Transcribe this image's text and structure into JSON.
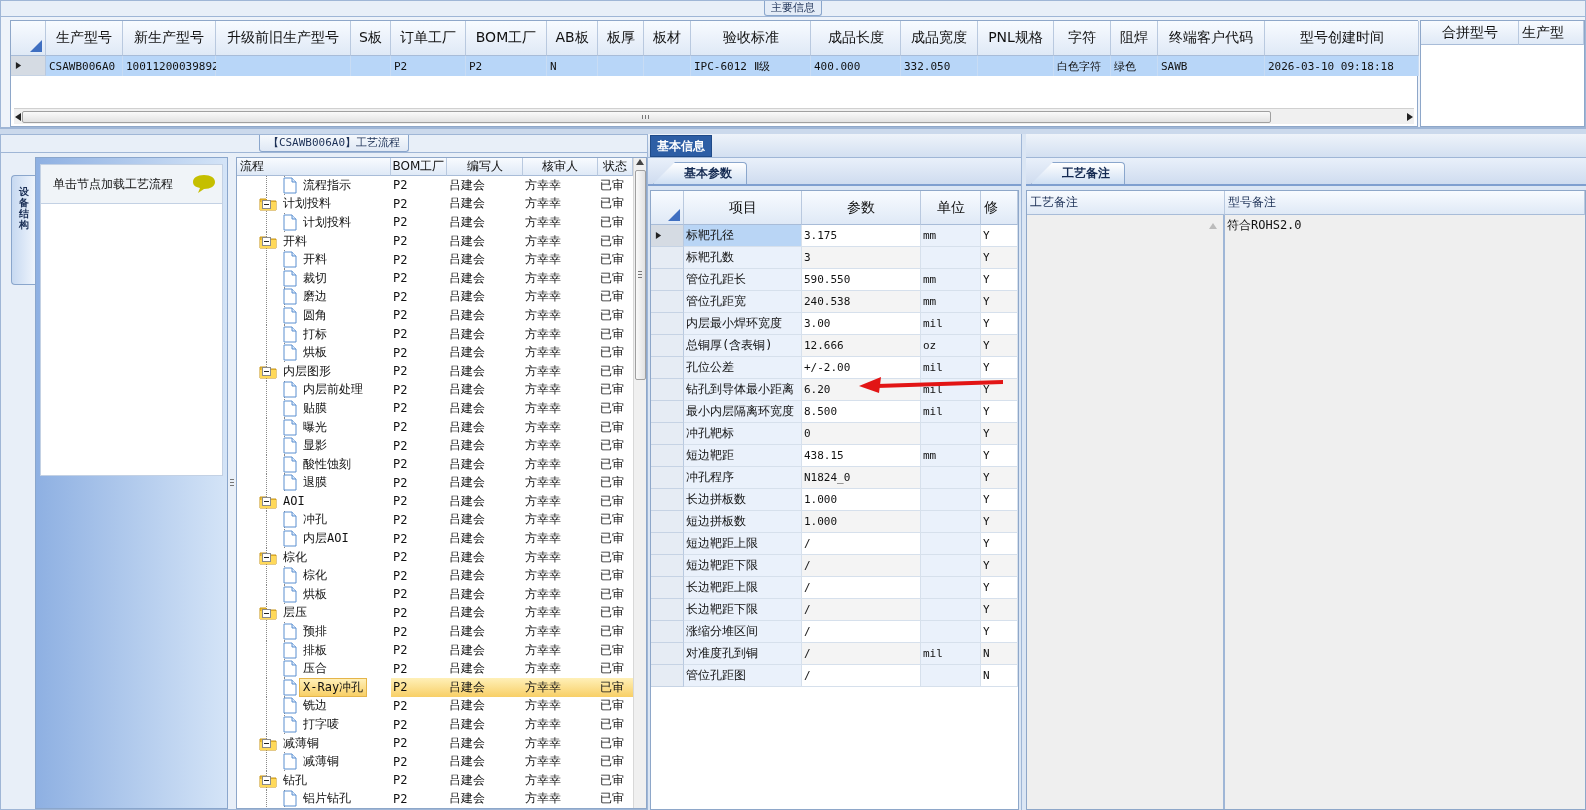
{
  "main_info": {
    "title": "主要信息",
    "columns": [
      "生产型号",
      "新生产型号",
      "升级前旧生产型号",
      "S板",
      "订单工厂",
      "BOM工厂",
      "AB板",
      "板厚",
      "板材",
      "验收标准",
      "成品长度",
      "成品宽度",
      "PNL规格",
      "字符",
      "阻焊",
      "终端客户代码",
      "型号创建时间"
    ],
    "rows": [
      {
        "selected": true,
        "cells": [
          "CSAWB006A0",
          "10011200039892",
          null,
          null,
          "P2",
          "P2",
          "N",
          null,
          null,
          "IPC-6012 Ⅱ级",
          "400.000",
          "332.050",
          null,
          "白色字符",
          "绿色",
          "SAWB",
          "2026-03-10 09:18:18"
        ]
      }
    ]
  },
  "merge_grid": {
    "columns": [
      "合拼型号",
      "生产型"
    ]
  },
  "process_flow": {
    "title": "【CSAWB006A0】工艺流程",
    "side_tab": "设备结构",
    "side_item": "单击节点加载工艺流程",
    "columns": [
      "流程",
      "BOM工厂",
      "编写人",
      "核审人",
      "状态"
    ],
    "nodes": [
      {
        "kind": "leaf",
        "label": "流程指示",
        "bom": "P2",
        "writer": "吕建会",
        "reviewer": "方幸幸",
        "status": "已审",
        "selected": false
      },
      {
        "kind": "folder",
        "label": "计划投料",
        "bom": "P2",
        "writer": "吕建会",
        "reviewer": "方幸幸",
        "status": "已审",
        "selected": false,
        "expanded": true,
        "children": [
          {
            "kind": "leaf",
            "label": "计划投料",
            "bom": "P2",
            "writer": "吕建会",
            "reviewer": "方幸幸",
            "status": "已审",
            "selected": false
          }
        ]
      },
      {
        "kind": "folder",
        "label": "开料",
        "bom": "P2",
        "writer": "吕建会",
        "reviewer": "方幸幸",
        "status": "已审",
        "selected": false,
        "expanded": true,
        "children": [
          {
            "kind": "leaf",
            "label": "开料",
            "bom": "P2",
            "writer": "吕建会",
            "reviewer": "方幸幸",
            "status": "已审",
            "selected": false
          },
          {
            "kind": "leaf",
            "label": "裁切",
            "bom": "P2",
            "writer": "吕建会",
            "reviewer": "方幸幸",
            "status": "已审",
            "selected": false
          },
          {
            "kind": "leaf",
            "label": "磨边",
            "bom": "P2",
            "writer": "吕建会",
            "reviewer": "方幸幸",
            "status": "已审",
            "selected": false
          },
          {
            "kind": "leaf",
            "label": "圆角",
            "bom": "P2",
            "writer": "吕建会",
            "reviewer": "方幸幸",
            "status": "已审",
            "selected": false
          },
          {
            "kind": "leaf",
            "label": "打标",
            "bom": "P2",
            "writer": "吕建会",
            "reviewer": "方幸幸",
            "status": "已审",
            "selected": false
          },
          {
            "kind": "leaf",
            "label": "烘板",
            "bom": "P2",
            "writer": "吕建会",
            "reviewer": "方幸幸",
            "status": "已审",
            "selected": false
          }
        ]
      },
      {
        "kind": "folder",
        "label": "内层图形",
        "bom": "P2",
        "writer": "吕建会",
        "reviewer": "方幸幸",
        "status": "已审",
        "selected": false,
        "expanded": true,
        "children": [
          {
            "kind": "leaf",
            "label": "内层前处理",
            "bom": "P2",
            "writer": "吕建会",
            "reviewer": "方幸幸",
            "status": "已审",
            "selected": false
          },
          {
            "kind": "leaf",
            "label": "贴膜",
            "bom": "P2",
            "writer": "吕建会",
            "reviewer": "方幸幸",
            "status": "已审",
            "selected": false
          },
          {
            "kind": "leaf",
            "label": "曝光",
            "bom": "P2",
            "writer": "吕建会",
            "reviewer": "方幸幸",
            "status": "已审",
            "selected": false
          },
          {
            "kind": "leaf",
            "label": "显影",
            "bom": "P2",
            "writer": "吕建会",
            "reviewer": "方幸幸",
            "status": "已审",
            "selected": false
          },
          {
            "kind": "leaf",
            "label": "酸性蚀刻",
            "bom": "P2",
            "writer": "吕建会",
            "reviewer": "方幸幸",
            "status": "已审",
            "selected": false
          },
          {
            "kind": "leaf",
            "label": "退膜",
            "bom": "P2",
            "writer": "吕建会",
            "reviewer": "方幸幸",
            "status": "已审",
            "selected": false
          }
        ]
      },
      {
        "kind": "folder",
        "label": "AOI",
        "bom": "P2",
        "writer": "吕建会",
        "reviewer": "方幸幸",
        "status": "已审",
        "selected": false,
        "expanded": true,
        "children": [
          {
            "kind": "leaf",
            "label": "冲孔",
            "bom": "P2",
            "writer": "吕建会",
            "reviewer": "方幸幸",
            "status": "已审",
            "selected": false
          },
          {
            "kind": "leaf",
            "label": "内层AOI",
            "bom": "P2",
            "writer": "吕建会",
            "reviewer": "方幸幸",
            "status": "已审",
            "selected": false
          }
        ]
      },
      {
        "kind": "folder",
        "label": "棕化",
        "bom": "P2",
        "writer": "吕建会",
        "reviewer": "方幸幸",
        "status": "已审",
        "selected": false,
        "expanded": true,
        "children": [
          {
            "kind": "leaf",
            "label": "棕化",
            "bom": "P2",
            "writer": "吕建会",
            "reviewer": "方幸幸",
            "status": "已审",
            "selected": false
          },
          {
            "kind": "leaf",
            "label": "烘板",
            "bom": "P2",
            "writer": "吕建会",
            "reviewer": "方幸幸",
            "status": "已审",
            "selected": false
          }
        ]
      },
      {
        "kind": "folder",
        "label": "层压",
        "bom": "P2",
        "writer": "吕建会",
        "reviewer": "方幸幸",
        "status": "已审",
        "selected": false,
        "expanded": true,
        "children": [
          {
            "kind": "leaf",
            "label": "预排",
            "bom": "P2",
            "writer": "吕建会",
            "reviewer": "方幸幸",
            "status": "已审",
            "selected": false
          },
          {
            "kind": "leaf",
            "label": "排板",
            "bom": "P2",
            "writer": "吕建会",
            "reviewer": "方幸幸",
            "status": "已审",
            "selected": false
          },
          {
            "kind": "leaf",
            "label": "压合",
            "bom": "P2",
            "writer": "吕建会",
            "reviewer": "方幸幸",
            "status": "已审",
            "selected": false
          },
          {
            "kind": "leaf",
            "label": "X-Ray冲孔",
            "bom": "P2",
            "writer": "吕建会",
            "reviewer": "方幸幸",
            "status": "已审",
            "selected": true
          },
          {
            "kind": "leaf",
            "label": "铣边",
            "bom": "P2",
            "writer": "吕建会",
            "reviewer": "方幸幸",
            "status": "已审",
            "selected": false
          },
          {
            "kind": "leaf",
            "label": "打字唛",
            "bom": "P2",
            "writer": "吕建会",
            "reviewer": "方幸幸",
            "status": "已审",
            "selected": false
          }
        ]
      },
      {
        "kind": "folder",
        "label": "减薄铜",
        "bom": "P2",
        "writer": "吕建会",
        "reviewer": "方幸幸",
        "status": "已审",
        "selected": false,
        "expanded": true,
        "children": [
          {
            "kind": "leaf",
            "label": "减薄铜",
            "bom": "P2",
            "writer": "吕建会",
            "reviewer": "方幸幸",
            "status": "已审",
            "selected": false
          }
        ]
      },
      {
        "kind": "folder",
        "label": "钻孔",
        "bom": "P2",
        "writer": "吕建会",
        "reviewer": "方幸幸",
        "status": "已审",
        "selected": false,
        "expanded": true,
        "children": [
          {
            "kind": "leaf",
            "label": "铝片钻孔",
            "bom": "P2",
            "writer": "吕建会",
            "reviewer": "方幸幸",
            "status": "已审",
            "selected": false
          }
        ]
      }
    ]
  },
  "basic_info": {
    "tab": {
      "label": "基本信息",
      "selected": true
    },
    "subtab": {
      "label": "基本参数",
      "selected": true
    },
    "columns": [
      "项目",
      "参数",
      "单位",
      "修"
    ],
    "rows": [
      {
        "item": "标靶孔径",
        "value": "3.175",
        "unit": "mm",
        "modified": "Y",
        "selected": true
      },
      {
        "item": "标靶孔数",
        "value": "3",
        "unit": null,
        "modified": "Y",
        "selected": false
      },
      {
        "item": "管位孔距长",
        "value": "590.550",
        "unit": "mm",
        "modified": "Y",
        "selected": false
      },
      {
        "item": "管位孔距宽",
        "value": "240.538",
        "unit": "mm",
        "modified": "Y",
        "selected": false
      },
      {
        "item": "内层最小焊环宽度",
        "value": "3.00",
        "unit": "mil",
        "modified": "Y",
        "selected": false
      },
      {
        "item": "总铜厚(含表铜)",
        "value": "12.666",
        "unit": "oz",
        "modified": "Y",
        "selected": false
      },
      {
        "item": "孔位公差",
        "value": "+/-2.00",
        "unit": "mil",
        "modified": "Y",
        "selected": false
      },
      {
        "item": "钻孔到导体最小距离",
        "value": "6.20",
        "unit": "mil",
        "modified": "Y",
        "selected": false
      },
      {
        "item": "最小内层隔离环宽度",
        "value": "8.500",
        "unit": "mil",
        "modified": "Y",
        "selected": false
      },
      {
        "item": "冲孔靶标",
        "value": "0",
        "unit": null,
        "modified": "Y",
        "selected": false
      },
      {
        "item": "短边靶距",
        "value": "438.15",
        "unit": "mm",
        "modified": "Y",
        "selected": false
      },
      {
        "item": "冲孔程序",
        "value": "N1824_0",
        "unit": null,
        "modified": "Y",
        "selected": false
      },
      {
        "item": "长边拼板数",
        "value": "1.000",
        "unit": null,
        "modified": "Y",
        "selected": false
      },
      {
        "item": "短边拼板数",
        "value": "1.000",
        "unit": null,
        "modified": "Y",
        "selected": false
      },
      {
        "item": "短边靶距上限",
        "value": "/",
        "unit": null,
        "modified": "Y",
        "selected": false
      },
      {
        "item": "短边靶距下限",
        "value": "/",
        "unit": null,
        "modified": "Y",
        "selected": false
      },
      {
        "item": "长边靶距上限",
        "value": "/",
        "unit": null,
        "modified": "Y",
        "selected": false
      },
      {
        "item": "长边靶距下限",
        "value": "/",
        "unit": null,
        "modified": "Y",
        "selected": false
      },
      {
        "item": "涨缩分堆区间",
        "value": "/",
        "unit": null,
        "modified": "Y",
        "selected": false
      },
      {
        "item": "对准度孔到铜",
        "value": "/",
        "unit": "mil",
        "modified": "N",
        "selected": false
      },
      {
        "item": "管位孔距图",
        "value": "/",
        "unit": null,
        "modified": "N",
        "selected": false
      }
    ]
  },
  "process_notes": {
    "subtab": {
      "label": "工艺备注",
      "selected": true
    },
    "columns": [
      "工艺备注",
      "型号备注"
    ],
    "model_note": "符合ROHS2.0"
  }
}
